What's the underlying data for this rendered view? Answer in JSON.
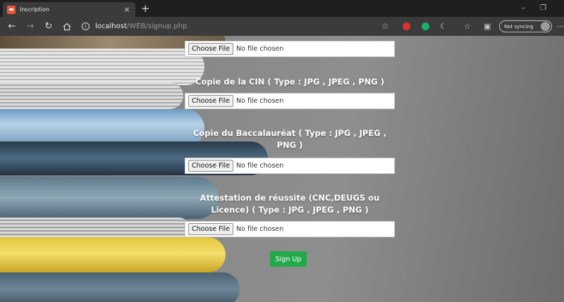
{
  "browser": {
    "tab_title": "Inscription",
    "tab_close": "×",
    "new_tab": "+",
    "url_host": "localhost",
    "url_path": "/WEB/signup.php",
    "sync_label": "Not syncing",
    "window_controls": {
      "minimize": "–",
      "restore": "❐"
    },
    "more": "⋯",
    "extension_colors": [
      "#e03131",
      "#16b26b"
    ]
  },
  "form": {
    "choose_label": "Choose File",
    "no_file_label": "No file chosen",
    "fields": [
      {
        "label": ""
      },
      {
        "label": "Copie de la CIN ( Type : JPG , JPEG , PNG )"
      },
      {
        "label": "Copie du Baccalauréat ( Type : JPG , JPEG , PNG )"
      },
      {
        "label": "Attestation de réussite (CNC,DEUGS ou Licence) ( Type : JPG , JPEG , PNG )"
      }
    ],
    "submit_label": "Sign Up",
    "submit_color": "#22a94a"
  }
}
